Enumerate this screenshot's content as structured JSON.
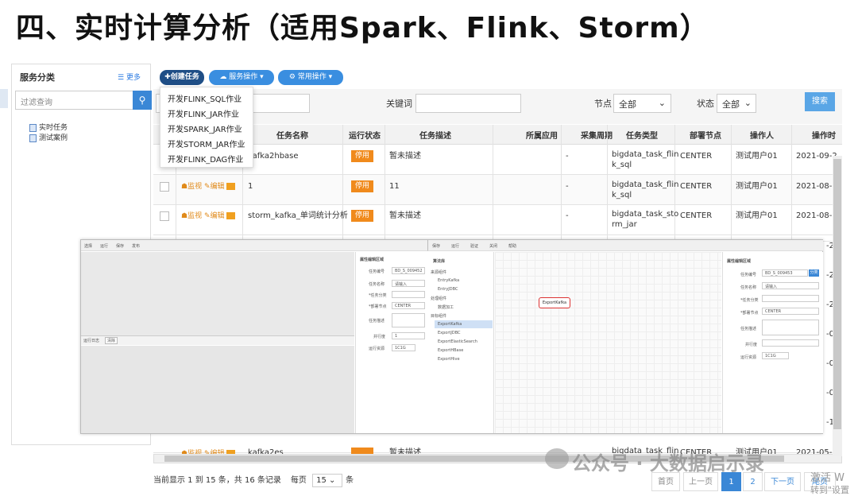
{
  "title": "四、实时计算分析（适用Spark、Flink、Storm）",
  "left_panel": {
    "header": "服务分类",
    "more": "更多",
    "filter_placeholder": "过滤查询",
    "tree": [
      "实时任务",
      "测试案例"
    ]
  },
  "toolbar": {
    "create": "✚创建任务",
    "service": "服务操作 ▾",
    "common": "常用操作 ▾"
  },
  "dropdown": [
    "开发FLINK_SQL作业",
    "开发FLINK_JAR作业",
    "开发SPARK_JAR作业",
    "开发STORM_JAR作业",
    "开发FLINK_DAG作业"
  ],
  "filters": {
    "keyword_label": "关键词",
    "node_label": "节点",
    "node_value": "全部",
    "status_label": "状态",
    "status_value": "全部",
    "search": "搜索"
  },
  "table": {
    "headers": [
      "任务名称",
      "运行状态",
      "任务描述",
      "所属应用",
      "采集周期",
      "任务类型",
      "部署节点",
      "操作人",
      "操作时"
    ],
    "rows": [
      {
        "name": "kafka2hbase",
        "status": "停用",
        "desc": "暂未描述",
        "period": "-",
        "type": "bigdata_task_flin\nk_sql",
        "node": "CENTER",
        "user": "测试用户01",
        "time": "2021-09-2"
      },
      {
        "name": "1",
        "status": "停用",
        "desc": "11",
        "period": "-",
        "type": "bigdata_task_flin\nk_sql",
        "node": "CENTER",
        "user": "测试用户01",
        "time": "2021-08-1"
      },
      {
        "name": "storm_kafka_单词统计分析",
        "status": "停用",
        "desc": "暂未描述",
        "period": "-",
        "type": "bigdata_task_sto\nrm_jar",
        "node": "CENTER",
        "user": "测试用户01",
        "time": "2021-08-0"
      },
      {
        "name": "kafka2es",
        "status": "停用",
        "desc": "暂未描述",
        "period": "-",
        "type": "bigdata_task_flin",
        "node": "CENTER",
        "user": "测试用户01",
        "time": "2021-05-0"
      }
    ],
    "ops": [
      "监视",
      "编辑"
    ],
    "side_times": [
      "-2",
      "-2",
      "-2",
      "-0",
      "-0",
      "-0",
      "-1"
    ]
  },
  "overlay": {
    "left_props_title": "属性编辑区域",
    "left_fields": [
      {
        "label": "任务编号",
        "value": "BD_S_009452"
      },
      {
        "label": "任务名称",
        "value": "请输入"
      },
      {
        "label": "*任务分类",
        "value": ""
      },
      {
        "label": "*部署节点",
        "value": "CENTER"
      },
      {
        "label": "任务描述",
        "value": ""
      },
      {
        "label": "并行度",
        "value": "1"
      },
      {
        "label": "运行资源",
        "value": "1C1G"
      }
    ],
    "log_label": "运行日志",
    "log_btn": "清除",
    "palette_title": "算法库",
    "palette_groups": [
      {
        "name": "来源组件",
        "items": [
          "EntryKafka",
          "EntryJDBC"
        ]
      },
      {
        "name": "处理组件",
        "items": [
          "数据加工"
        ]
      },
      {
        "name": "目标组件",
        "items": [
          "ExportKafka",
          "ExportJDBC",
          "ExportElasticSearch",
          "ExportHBase",
          "ExportHive"
        ]
      }
    ],
    "canvas_node": "ExportKafka",
    "right_props_title": "属性编辑区域",
    "right_fields": [
      {
        "label": "任务编号",
        "value": "BD_S_009453"
      },
      {
        "label": "任务名称",
        "value": "请输入"
      },
      {
        "label": "*任务分类",
        "value": ""
      },
      {
        "label": "*部署节点",
        "value": "CENTER"
      },
      {
        "label": "任务描述",
        "value": ""
      },
      {
        "label": "并行度",
        "value": ""
      },
      {
        "label": "运行资源",
        "value": "1C1G"
      }
    ],
    "right_btn": "分类",
    "tool_left": [
      "选择",
      "运行",
      "保存",
      "发布"
    ],
    "tool_right": [
      "保存",
      "运行",
      "验证",
      "关闭",
      "帮助"
    ]
  },
  "pagination": {
    "info": "当前显示 1 到 15 条，共 16 条记录",
    "per_label": "每页",
    "per_value": "15",
    "per_unit": "条",
    "first": "首页",
    "prev": "上一页",
    "pages": [
      "1",
      "2"
    ],
    "next": "下一页",
    "last": "尾页"
  },
  "watermark": "公众号 · 大数据启示录",
  "corner_text": "激活 W",
  "corner_text2": "转到\"设置"
}
